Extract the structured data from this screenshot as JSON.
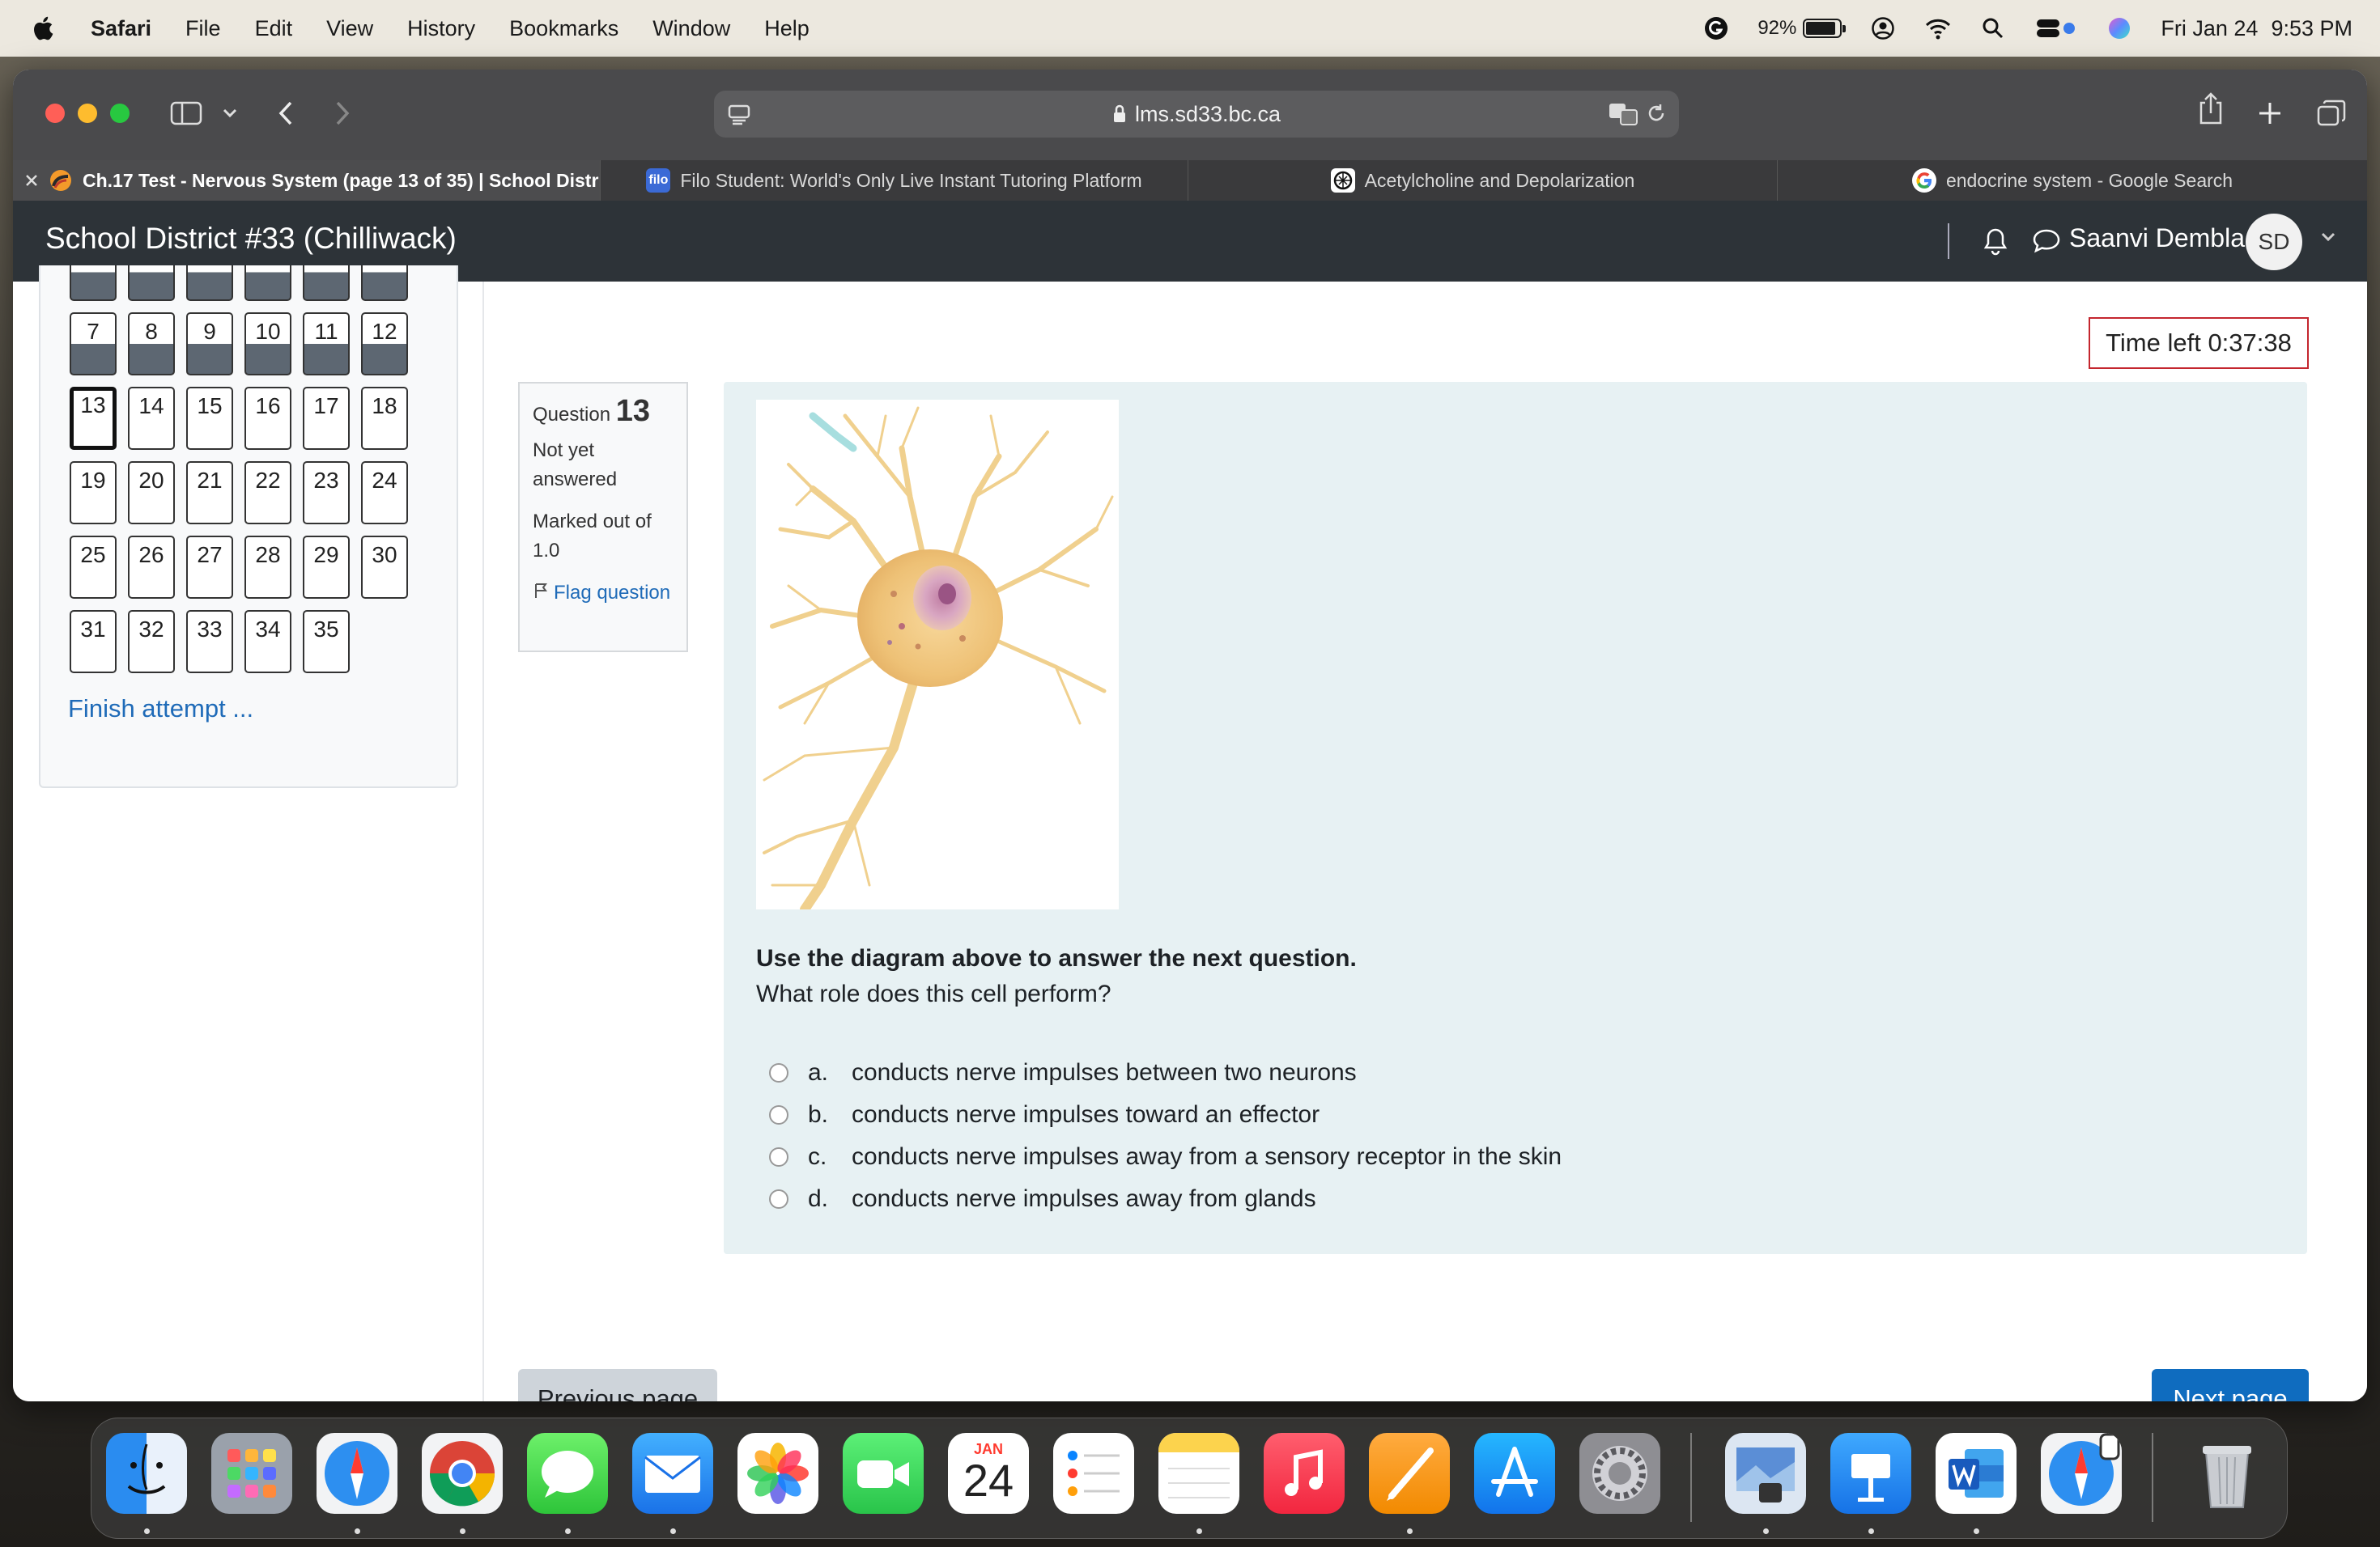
{
  "menubar": {
    "app": "Safari",
    "items": [
      "File",
      "Edit",
      "View",
      "History",
      "Bookmarks",
      "Window",
      "Help"
    ],
    "battery": "92%",
    "date": "Fri Jan 24",
    "time": "9:53 PM"
  },
  "browser": {
    "url": "lms.sd33.bc.ca",
    "tabs": [
      {
        "title": "Ch.17 Test - Nervous System (page 13 of 35) | School Distri...",
        "active": true
      },
      {
        "title": "Filo Student: World's Only Live Instant Tutoring Platform",
        "favicon_text": "filo"
      },
      {
        "title": "Acetylcholine and Depolarization"
      },
      {
        "title": "endocrine system - Google Search"
      }
    ]
  },
  "site": {
    "name": "School District #33 (Chilliwack)",
    "user_name": "Saanvi Dembla",
    "user_initials": "SD"
  },
  "quiz_nav": {
    "rows": [
      [
        "7",
        "8",
        "9",
        "10",
        "11",
        "12"
      ],
      [
        "13",
        "14",
        "15",
        "16",
        "17",
        "18"
      ],
      [
        "19",
        "20",
        "21",
        "22",
        "23",
        "24"
      ],
      [
        "25",
        "26",
        "27",
        "28",
        "29",
        "30"
      ],
      [
        "31",
        "32",
        "33",
        "34",
        "35"
      ]
    ],
    "current": "13",
    "finish_label": "Finish attempt ..."
  },
  "timer": "Time left 0:37:38",
  "question": {
    "label": "Question",
    "number": "13",
    "status": "Not yet answered",
    "marks": "Marked out of 1.0",
    "flag_label": "Flag question",
    "prompt_bold": "Use the diagram above to answer the next question.",
    "text": "What role does this cell perform?",
    "options": [
      {
        "letter": "a.",
        "text": "conducts nerve impulses between two neurons"
      },
      {
        "letter": "b.",
        "text": "conducts nerve impulses toward an effector"
      },
      {
        "letter": "c.",
        "text": "conducts nerve impulses away from a sensory receptor in the skin"
      },
      {
        "letter": "d.",
        "text": "conducts nerve impulses away from glands"
      }
    ]
  },
  "buttons": {
    "previous": "Previous page",
    "next": "Next page"
  },
  "dock": {
    "calendar_month": "JAN",
    "calendar_day": "24",
    "apps": [
      "finder",
      "launchpad",
      "safari",
      "chrome",
      "messages",
      "mail",
      "photos",
      "facetime",
      "calendar",
      "reminders",
      "notes",
      "music",
      "pages",
      "app-store",
      "system-settings",
      "preview",
      "keynote",
      "word",
      "safari-web-app",
      "trash"
    ]
  },
  "colors": {
    "header_bg": "#2d3338",
    "link": "#1f6bb8",
    "primary_button": "#0f6cbf",
    "question_bg": "#e7f1f3",
    "timer_border": "#c4262e"
  }
}
